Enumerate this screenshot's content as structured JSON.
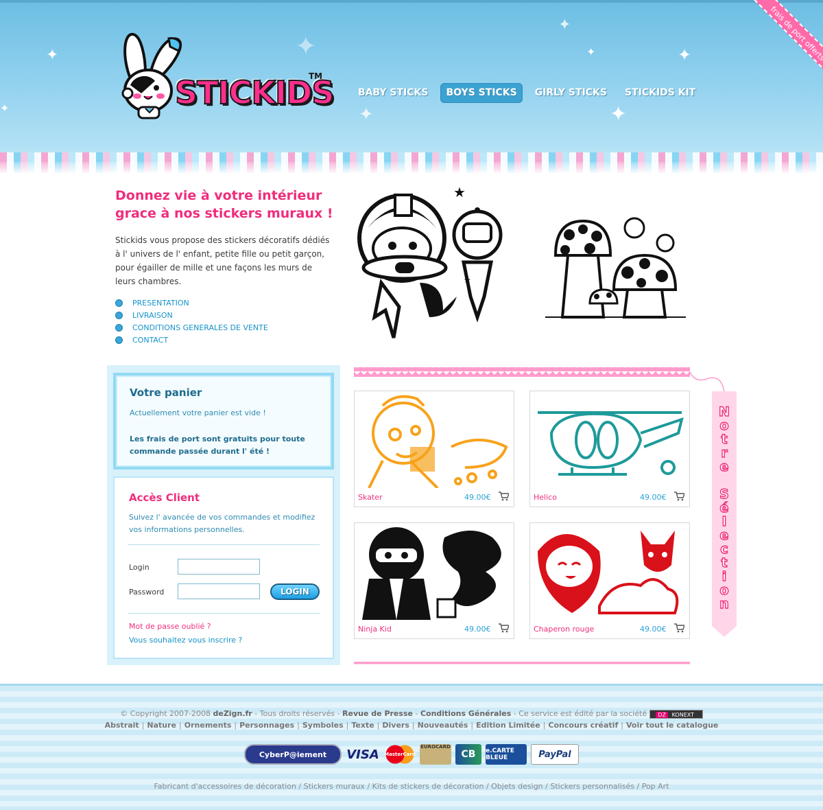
{
  "brand": {
    "name": "STICKIDS",
    "tm": "TM"
  },
  "nav": {
    "items": [
      {
        "label": "BABY STICKS"
      },
      {
        "label": "BOYS STICKS",
        "active": true
      },
      {
        "label": "GIRLY STICKS"
      },
      {
        "label": "STICKIDS KIT"
      }
    ]
  },
  "ribbon": "frais de port offerts",
  "intro": {
    "title": "Donnez vie à votre intérieur grace à nos stickers muraux !",
    "text": "Stickids vous propose des stickers décoratifs dédiés à l' univers de l' enfant, petite fille ou petit garçon, pour égailler de mille et une façons les murs de leurs chambres.",
    "links": [
      "PRESENTATION",
      "LIVRAISON",
      "CONDITIONS GENERALES DE VENTE",
      "CONTACT"
    ]
  },
  "panier": {
    "title": "Votre panier",
    "status": "Actuellement votre panier est vide !",
    "note": "Les frais de port sont gratuits pour toute commande passée durant l' été !"
  },
  "acces": {
    "title": "Accès Client",
    "desc": "Suivez l' avancée de vos commandes et modifiez vos informations personnelles.",
    "login_label": "Login",
    "password_label": "Password",
    "login_button": "LOGIN",
    "forgot": "Mot de passe oublié ?",
    "signup": "Vous souhaitez vous inscrire ?"
  },
  "selection": {
    "tab_label": "Notre Sélection",
    "products": [
      {
        "name": "Skater",
        "price": "49.00€",
        "color": "#f7a21b"
      },
      {
        "name": "Helico",
        "price": "49.00€",
        "color": "#1e9a9a"
      },
      {
        "name": "Ninja Kid",
        "price": "49.00€",
        "color": "#111111"
      },
      {
        "name": "Chaperon rouge",
        "price": "49.00€",
        "color": "#d9111a"
      }
    ]
  },
  "footer": {
    "copyright": "© Copyright 2007-2008",
    "site": "deZign.fr",
    "rights": "- Tous droits réservés -",
    "press": "Revue de Presse",
    "dash": "-",
    "conditions": "Conditions Générales",
    "edited": "- Ce service est édité par la société",
    "konext_left": "DZ",
    "konext_right": "KONEXT",
    "categories": [
      "Abstrait",
      "Nature",
      "Ornements",
      "Personnages",
      "Symboles",
      "Texte",
      "Divers",
      "Nouveautés",
      "Edition Limitée",
      "Concours créatif",
      "Voir tout le catalogue"
    ],
    "tags": "Fabricant d'accessoires de décoration / Stickers muraux / Kits de stickers de décoration / Objets design / Stickers personnalisés / Pop Art",
    "payments": [
      "CyberP@iement",
      "VISA",
      "MasterCard",
      "EUROCARD",
      "CB",
      "e.CARTE BLEUE",
      "PayPal"
    ]
  }
}
